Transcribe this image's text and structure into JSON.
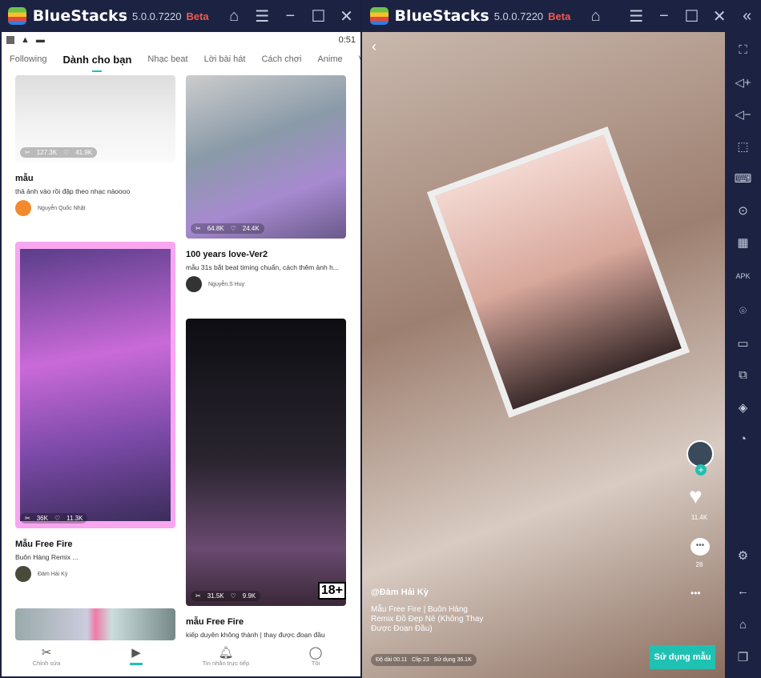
{
  "app": {
    "name": "BlueStacks",
    "version": "5.0.0.7220",
    "tag": "Beta"
  },
  "left": {
    "status_time": "0:51",
    "tabs": [
      "Following",
      "Dành cho bạn",
      "Nhạc beat",
      "Lời bài hát",
      "Cách chơi",
      "Anime",
      "Vlog"
    ],
    "cards": [
      {
        "uses": "127.3K",
        "likes": "41.9K",
        "title": "mẫu",
        "desc": "thả ảnh vào rồi đập theo nhạc nàoooo",
        "author": "Nguyễn Quốc Nhật"
      },
      {
        "uses": "36K",
        "likes": "11.3K",
        "title": "Mẫu Free Fire",
        "desc": "Buôn Hàng Remix ...",
        "author": "Đàm Hải Kỳ"
      },
      {
        "uses": "64.8K",
        "likes": "24.4K",
        "title": "100 years love-Ver2",
        "desc": "mẫu 31s bắt beat timing chuẩn, cách thêm ảnh h...",
        "author": "Nguyễn.S Huy"
      },
      {
        "uses": "31.5K",
        "likes": "9.9K",
        "title": "mẫu Free Fire",
        "desc": "kiếp duyên không thành | thay được đoạn đầu",
        "badge": "18+"
      }
    ],
    "nav": [
      "Chỉnh sửa",
      "",
      "Tin nhắn trực tiếp",
      "Tôi"
    ]
  },
  "right": {
    "likes": "11.4K",
    "comments": "28",
    "author": "@Đàm Hải Kỳ",
    "desc": "Mẫu Free Fire | Buôn Hàng Remix Đồ Đẹp Nè (Không Thay Được Đoạn Đầu)",
    "meta": "Độ dài 00.11   Clip 23   Sử dụng 36.1K",
    "use_button": "Sử dụng mẫu"
  },
  "colors": {
    "accent": "#1fc1b2",
    "chrome": "#1c2241",
    "beta": "#f05a4f"
  }
}
